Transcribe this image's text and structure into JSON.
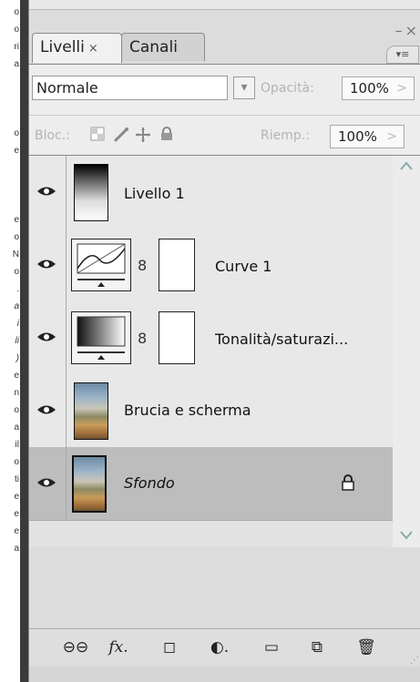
{
  "background_text": {
    "lines": [
      "o",
      "o",
      "ri",
      "a",
      "o",
      "e",
      "e",
      "o",
      "N",
      "o",
      ".",
      "a",
      "i",
      "li",
      ")",
      "e",
      "n",
      "o",
      "a",
      "il",
      "o",
      "ti",
      "e",
      "e",
      "e",
      "a"
    ]
  },
  "panel": {
    "tabs": [
      {
        "label": "Livelli",
        "close": "×",
        "active": true
      },
      {
        "label": "Canali",
        "active": false
      }
    ],
    "window_buttons": {
      "minimize": "–",
      "close": "×"
    },
    "menu_button": "▾≡",
    "blend_mode": "Normale",
    "blend_arrow": "▾",
    "opacity_label": "Opacità:",
    "opacity_value": "100%",
    "lock_label": "Bloc.:",
    "fill_label": "Riemp.:",
    "fill_value": "100%",
    "arrow_right": ">"
  },
  "layers": [
    {
      "name": "Livello 1",
      "italic": false,
      "selected": false
    },
    {
      "name": "Curve 1",
      "italic": false,
      "selected": false
    },
    {
      "name": "Tonalità/saturazi...",
      "italic": false,
      "selected": false
    },
    {
      "name": "Brucia e scherma",
      "italic": false,
      "selected": false
    },
    {
      "name": "Sfondo",
      "italic": true,
      "selected": true,
      "locked": true
    }
  ],
  "bottom_toolbar": [
    {
      "name": "link-layers-icon",
      "glyph": "⊖⊖"
    },
    {
      "name": "fx-icon",
      "glyph": "fx."
    },
    {
      "name": "mask-icon",
      "glyph": "◻"
    },
    {
      "name": "adjustment-icon",
      "glyph": "◐."
    },
    {
      "name": "folder-icon",
      "glyph": "▭"
    },
    {
      "name": "new-layer-icon",
      "glyph": "⧉"
    },
    {
      "name": "trash-icon",
      "glyph": "🗑"
    }
  ],
  "colors": {
    "selected_row": "#bdbdbd",
    "panel_bg": "#dcdcdc"
  }
}
